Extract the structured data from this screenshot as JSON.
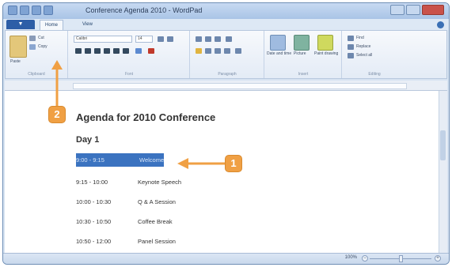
{
  "window": {
    "title": "Conference Agenda 2010 - WordPad"
  },
  "tabs": {
    "file": "",
    "home": "Home",
    "view": "View"
  },
  "ribbon": {
    "clipboard": {
      "paste": "Paste",
      "cut": "Cut",
      "copy": "Copy",
      "label": "Clipboard"
    },
    "font": {
      "family": "Calibri",
      "size": "14",
      "label": "Font"
    },
    "paragraph": {
      "label": "Paragraph"
    },
    "insert": {
      "picture": "Picture",
      "paint": "Paint drawing",
      "datetime": "Date and time",
      "label": "Insert"
    },
    "editing": {
      "find": "Find",
      "replace": "Replace",
      "select_all": "Select all",
      "label": "Editing"
    }
  },
  "document": {
    "title": "Agenda for 2010 Conference",
    "day": "Day 1",
    "rows": [
      {
        "time": "9:00 - 9:15",
        "event": "Welcome"
      },
      {
        "time": "9:15 - 10:00",
        "event": "Keynote Speech"
      },
      {
        "time": "10:00 - 10:30",
        "event": "Q & A Session"
      },
      {
        "time": "10:30 - 10:50",
        "event": "Coffee Break"
      },
      {
        "time": "10:50 - 12:00",
        "event": "Panel Session"
      }
    ]
  },
  "status": {
    "zoom": "100%"
  },
  "callouts": {
    "step1": "1",
    "step2": "2"
  },
  "colors": {
    "accent": "#3b73c0",
    "callout": "#f0a044"
  }
}
